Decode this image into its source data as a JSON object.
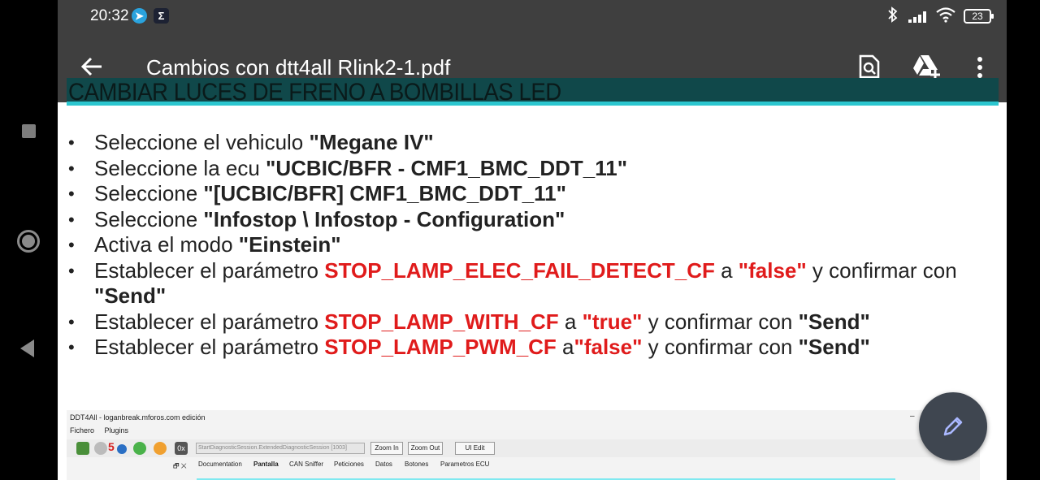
{
  "status_bar": {
    "time": "20:32",
    "left_icons": [
      "telegram-icon",
      "sigma-icon"
    ],
    "right_icons": [
      "bluetooth-icon",
      "signal-icon",
      "wifi-icon",
      "battery-icon"
    ],
    "sigma": "Σ",
    "battery": "23"
  },
  "toolbar": {
    "title": "Cambios con dtt4all Rlink2-1.pdf",
    "actions": [
      "search-in-document-icon",
      "drive-add-icon",
      "more-options-icon"
    ]
  },
  "document": {
    "heading": "CAMBIAR LUCES DE FRENO A BOMBILLAS  LED",
    "steps": [
      {
        "t1": "Seleccione el vehiculo ",
        "b1": "\"Megane IV\""
      },
      {
        "t1": "Seleccione la ecu ",
        "b1": "\"UCBIC/BFR - CMF1_BMC_DDT_11\""
      },
      {
        "t1": "Seleccione ",
        "b1": "\"[UCBIC/BFR] CMF1_BMC_DDT_11\""
      },
      {
        "t1": "Seleccione ",
        "b1": "\"Infostop \\ Infostop - Configuration\""
      },
      {
        "t1": "Activa el modo ",
        "b1": "\"Einstein\""
      },
      {
        "t1": "Establecer el parámetro ",
        "r1": "STOP_LAMP_ELEC_FAIL_DETECT_CF",
        "t2": " a ",
        "r2": "\"false\"",
        "t3": " y confirmar con ",
        "b1": "\"Send\""
      },
      {
        "t1": "Establecer el parámetro ",
        "r1": "STOP_LAMP_WITH_CF",
        "t2": " a ",
        "r2": "\"true\"",
        "t3": " y confirmar con ",
        "b1": "\"Send\""
      },
      {
        "t1": "Establecer el parámetro ",
        "r1": "STOP_LAMP_PWM_CF",
        "t2": " a",
        "r2": "\"false\"",
        "t3": " y confirmar con ",
        "b1": "\"Send\""
      }
    ],
    "embedded_app": {
      "window_title": "DDT4All - loganbreak.mforos.com edición",
      "minimize": "–",
      "menu": [
        "Fichero",
        "Plugins"
      ],
      "session": "StartDiagnosticSession.ExtendedDiagnosticSession [1003]",
      "hex_label": "0x",
      "counter": "5",
      "buttons": [
        "Zoom In",
        "Zoom Out",
        "UI Edit"
      ],
      "pane_controls": "🗗 ✕",
      "tabs": [
        "Documentation",
        "Pantalla",
        "CAN Sniffer",
        "Peticiones",
        "Datos",
        "Botones",
        "Parametros ECU"
      ]
    }
  },
  "fab": {
    "icon": "edit-pencil-icon"
  },
  "navigation": [
    "recents-square-icon",
    "home-circle-icon",
    "back-triangle-icon"
  ],
  "colors": {
    "toolbar": "#3f3f3f",
    "banner": "#10484a",
    "banner_border": "#2bc6cf",
    "highlight_red": "#e01b1b",
    "fab": "#3f4650"
  }
}
